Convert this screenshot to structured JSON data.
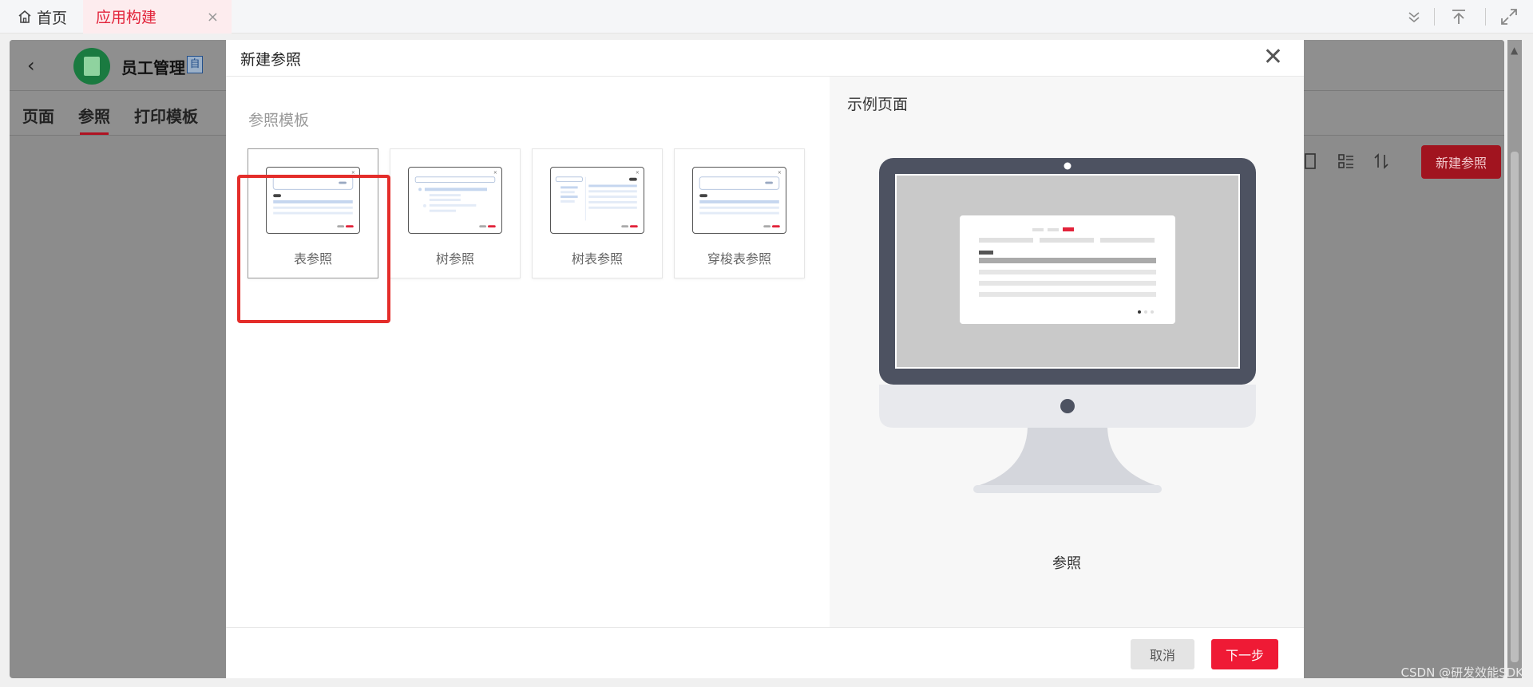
{
  "tabs": {
    "home_label": "首页",
    "app_label": "应用构建",
    "close_glyph": "×"
  },
  "app": {
    "back_glyph": "‹",
    "title": "员工管理",
    "badge": "自",
    "nav": [
      "页面",
      "参照",
      "打印模板"
    ],
    "active_nav": "参照",
    "new_button": "新建参照"
  },
  "modal": {
    "title": "新建参照",
    "close_glyph": "✕",
    "section_label": "参照模板",
    "templates": [
      {
        "name": "表参照",
        "selected": true
      },
      {
        "name": "树参照",
        "selected": false
      },
      {
        "name": "树表参照",
        "selected": false
      },
      {
        "name": "穿梭表参照",
        "selected": false
      }
    ],
    "preview_label": "示例页面",
    "preview_caption": "参照",
    "cancel_label": "取消",
    "next_label": "下一步"
  },
  "watermark": "CSDN @研发效能SDK",
  "colors": {
    "brand_red": "#ef1a35",
    "selection_red": "#e42d2a",
    "overlay_gray": "#8c8c8c"
  }
}
